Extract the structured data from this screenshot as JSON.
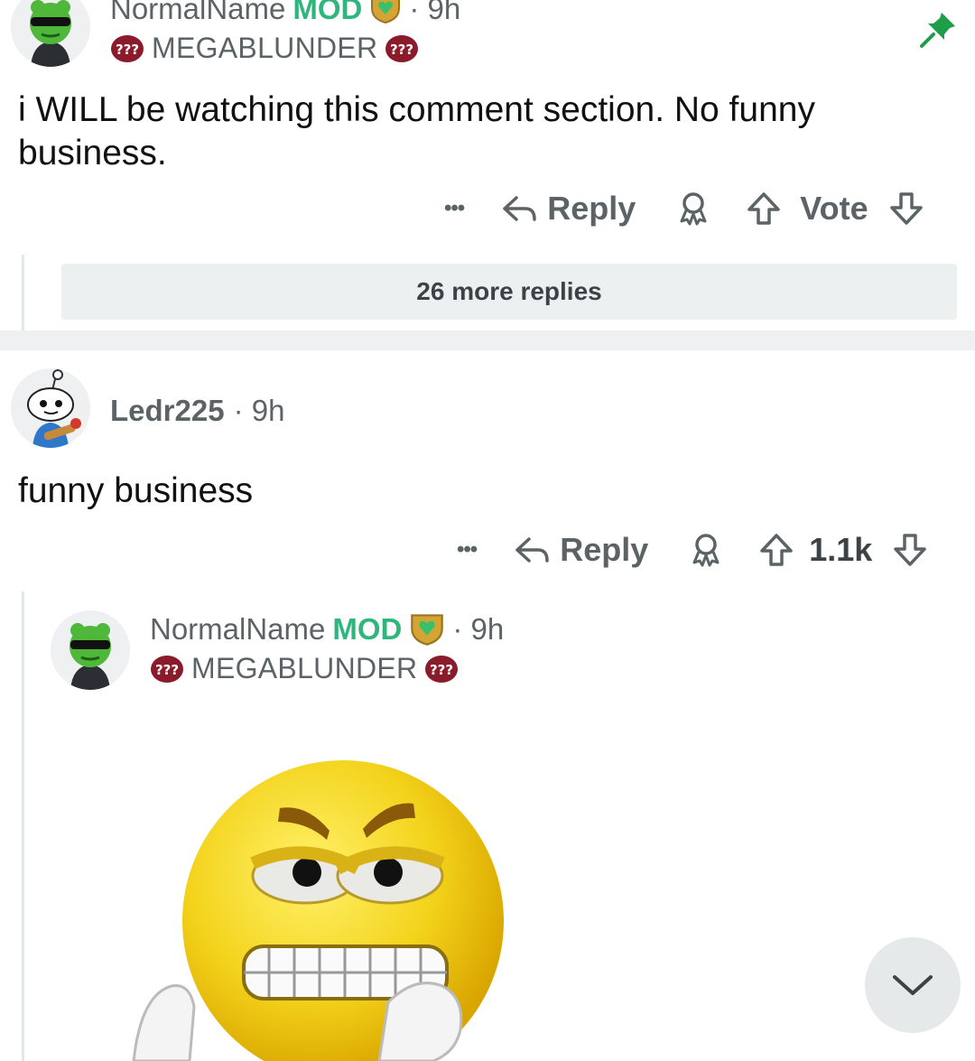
{
  "comment1": {
    "username": "NormalName",
    "mod_label": "MOD",
    "time": "· 9h",
    "flair": "MEGABLUNDER",
    "body": "i WILL be watching this comment section. No funny business.",
    "actions": {
      "more": "•••",
      "reply": "Reply",
      "vote": "Vote"
    },
    "more_replies": "26 more replies"
  },
  "comment2": {
    "username": "Ledr225",
    "time": "· 9h",
    "body": "funny business",
    "actions": {
      "more": "•••",
      "reply": "Reply",
      "vote": "1.1k"
    }
  },
  "reply1": {
    "username": "NormalName",
    "mod_label": "MOD",
    "time": "· 9h",
    "flair": "MEGABLUNDER",
    "image": "angry-emoji-image"
  },
  "icons": {
    "pin": "pin-icon",
    "reply": "reply-arrow-icon",
    "award": "award-icon",
    "upvote": "upvote-icon",
    "downvote": "downvote-icon",
    "scroll": "chevron-down-icon"
  },
  "colors": {
    "mod_green": "#2eb67d",
    "flair_red": "#8b1a2b",
    "pin_green": "#1f9e4a",
    "meta_gray": "#5c6367"
  }
}
